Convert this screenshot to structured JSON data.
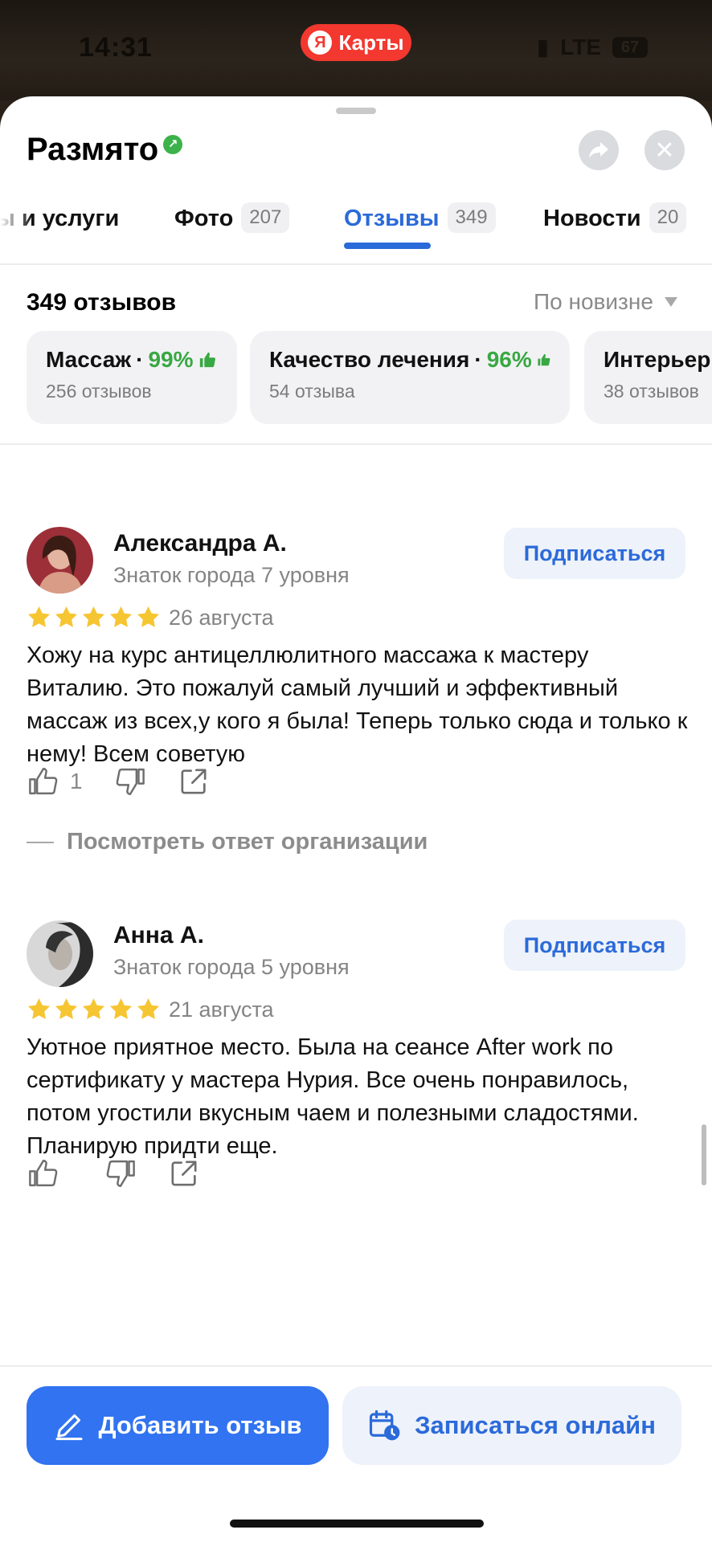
{
  "status_bar": {
    "time": "14:31",
    "network": "LTE",
    "battery": "67"
  },
  "maps_badge": {
    "logo": "Я",
    "label": "Карты"
  },
  "header": {
    "title": "Размято"
  },
  "tabs": [
    {
      "label": "ы и услуги",
      "count": ""
    },
    {
      "label": "Фото",
      "count": "207"
    },
    {
      "label": "Отзывы",
      "count": "349"
    },
    {
      "label": "Новости",
      "count": "20"
    }
  ],
  "reviews_header": {
    "count_label": "349 отзывов",
    "sort_label": "По новизне"
  },
  "aspects": [
    {
      "name": "Массаж",
      "sep": "·",
      "percent": "99%",
      "sub": "256 отзывов"
    },
    {
      "name": "Качество лечения",
      "sep": "·",
      "percent": "96%",
      "sub": "54 отзыва"
    },
    {
      "name": "Интерьер",
      "sep": "",
      "percent": "",
      "sub": "38 отзывов"
    }
  ],
  "reviews": [
    {
      "author": "Александра А.",
      "level": "Знаток города 7 уровня",
      "subscribe": "Подписаться",
      "rating": 5,
      "date": "26 августа",
      "text": "Хожу на курс антицеллюлитного массажа к мастеру Виталию. Это пожалуй самый лучший и эффективный массаж из всех,у кого я была! Теперь только сюда и только к нему! Всем советую",
      "likes": "1",
      "reply_link": "Посмотреть ответ организации"
    },
    {
      "author": "Анна А.",
      "level": "Знаток города 5 уровня",
      "subscribe": "Подписаться",
      "rating": 5,
      "date": "21 августа",
      "text": "Уютное приятное место. Была на сеансе After work по сертификату у мастера Нурия. Все очень понравилось, потом угостили вкусным чаем и полезными сладостями. Планирую придти еще.",
      "likes": ""
    }
  ],
  "bottom": {
    "add_review": "Добавить отзыв",
    "book_online": "Записаться онлайн"
  },
  "colors": {
    "accent": "#2b6ad9",
    "primary_button": "#3173f0",
    "positive": "#38a843",
    "star": "#f6c532",
    "maps_red": "#f2382f"
  }
}
